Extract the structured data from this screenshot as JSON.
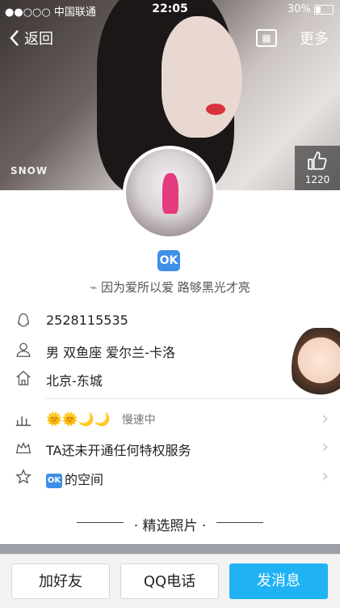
{
  "status_bar": {
    "carrier": "●●○○○ 中国联通",
    "time": "22:05",
    "battery": "30%"
  },
  "nav": {
    "back_label": "返回",
    "more_label": "更多"
  },
  "cover": {
    "watermark": "SNOW",
    "like_count": "1220"
  },
  "profile": {
    "badge": "OK",
    "signature": "因为爱所以爱 路够黑光才亮",
    "qq_number": "2528115535",
    "personal_info": "男 双鱼座 爱尔兰-卡洛",
    "location": "北京-东城",
    "level_suns": "🌞🌞",
    "level_moons": "🌙🌙",
    "level_status": "慢速中",
    "privilege": "TA还未开通任何特权服务",
    "space_badge": "OK",
    "space_label": "的空间"
  },
  "section": {
    "title": "精选照片"
  },
  "bottom": {
    "add_friend": "加好友",
    "call": "QQ电话",
    "message": "发消息"
  },
  "colors": {
    "accent": "#1fb3f3",
    "ok_badge": "#3f8ee8"
  }
}
